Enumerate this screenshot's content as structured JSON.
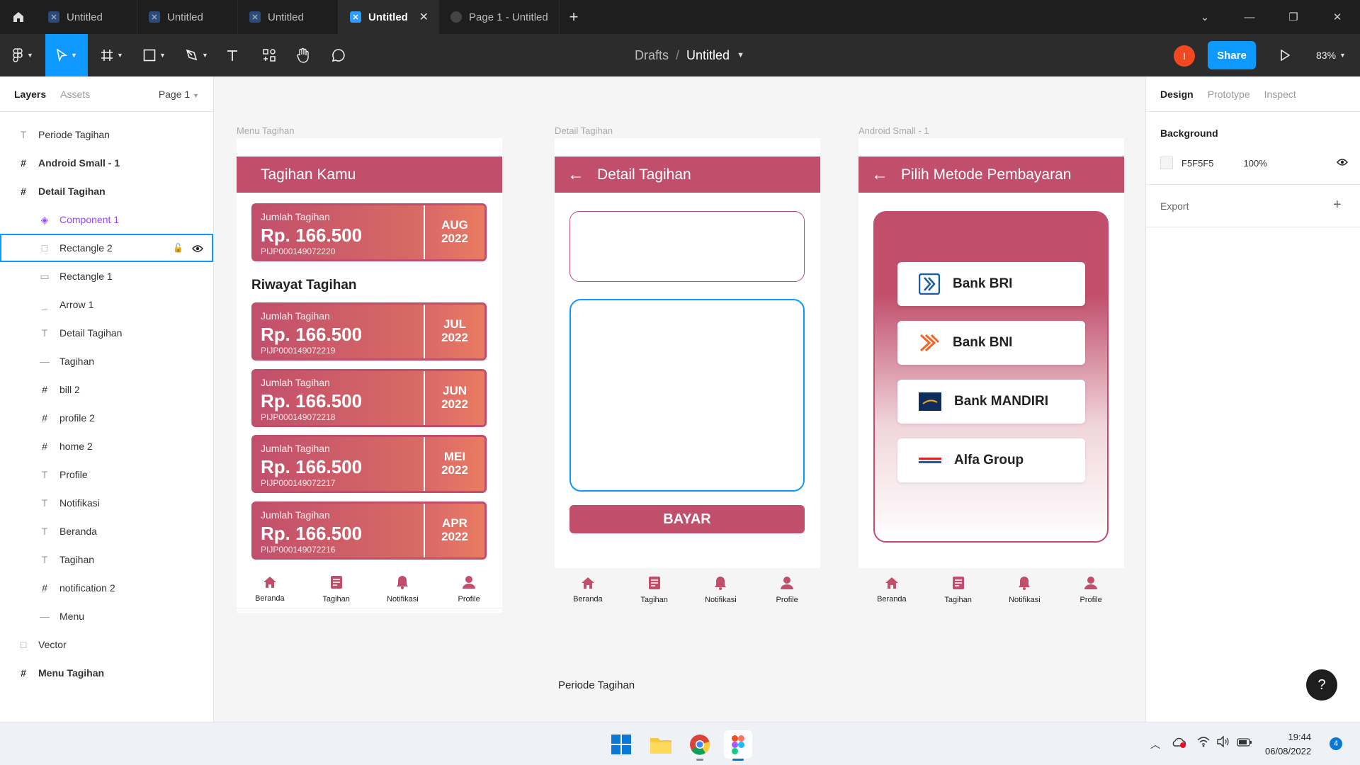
{
  "tabs": [
    {
      "label": "Untitled",
      "active": false
    },
    {
      "label": "Untitled",
      "active": false
    },
    {
      "label": "Untitled",
      "active": false
    },
    {
      "label": "Untitled",
      "active": true
    },
    {
      "label": "Page 1 - Untitled",
      "active": false
    }
  ],
  "toolbar": {
    "breadcrumb_parent": "Drafts",
    "breadcrumb_sep": "/",
    "file_name": "Untitled",
    "avatar_initial": "I",
    "share_label": "Share",
    "zoom": "83%"
  },
  "left_panel": {
    "tab_layers": "Layers",
    "tab_assets": "Assets",
    "page": "Page 1",
    "layers": [
      {
        "label": "Periode Tagihan",
        "icon": "T",
        "indent": 0,
        "bold": false
      },
      {
        "label": "Android Small - 1",
        "icon": "#",
        "indent": 0,
        "bold": true
      },
      {
        "label": "Detail Tagihan",
        "icon": "#",
        "indent": 0,
        "bold": true
      },
      {
        "label": "Component 1",
        "icon": "◈",
        "indent": 1,
        "bold": false,
        "component": true
      },
      {
        "label": "Rectangle 2",
        "icon": "□",
        "indent": 1,
        "bold": false,
        "selected": true
      },
      {
        "label": "Rectangle 1",
        "icon": "▭",
        "indent": 1,
        "bold": false
      },
      {
        "label": "Arrow 1",
        "icon": "_",
        "indent": 1,
        "bold": false
      },
      {
        "label": "Detail Tagihan",
        "icon": "T",
        "indent": 1,
        "bold": false
      },
      {
        "label": "Tagihan",
        "icon": "—",
        "indent": 1,
        "bold": false
      },
      {
        "label": "bill 2",
        "icon": "#",
        "indent": 1,
        "bold": false
      },
      {
        "label": "profile 2",
        "icon": "#",
        "indent": 1,
        "bold": false
      },
      {
        "label": "home 2",
        "icon": "#",
        "indent": 1,
        "bold": false
      },
      {
        "label": "Profile",
        "icon": "T",
        "indent": 1,
        "bold": false
      },
      {
        "label": "Notifikasi",
        "icon": "T",
        "indent": 1,
        "bold": false
      },
      {
        "label": "Beranda",
        "icon": "T",
        "indent": 1,
        "bold": false
      },
      {
        "label": "Tagihan",
        "icon": "T",
        "indent": 1,
        "bold": false
      },
      {
        "label": "notification 2",
        "icon": "#",
        "indent": 1,
        "bold": false
      },
      {
        "label": "Menu",
        "icon": "—",
        "indent": 1,
        "bold": false
      },
      {
        "label": "Vector",
        "icon": "□",
        "indent": 0,
        "bold": false
      },
      {
        "label": "Menu Tagihan",
        "icon": "#",
        "indent": 0,
        "bold": true
      }
    ]
  },
  "canvas": {
    "frame1": {
      "label": "Menu Tagihan",
      "title": "Tagihan Kamu",
      "history_title": "Riwayat Tagihan",
      "current_bill": {
        "label": "Jumlah Tagihan",
        "amount": "Rp. 166.500",
        "code": "PIJP000149072220",
        "month": "AUG",
        "year": "2022"
      },
      "bills": [
        {
          "label": "Jumlah Tagihan",
          "amount": "Rp. 166.500",
          "code": "PIJP000149072219",
          "month": "JUL",
          "year": "2022"
        },
        {
          "label": "Jumlah Tagihan",
          "amount": "Rp. 166.500",
          "code": "PIJP000149072218",
          "month": "JUN",
          "year": "2022"
        },
        {
          "label": "Jumlah Tagihan",
          "amount": "Rp. 166.500",
          "code": "PIJP000149072217",
          "month": "MEI",
          "year": "2022"
        },
        {
          "label": "Jumlah Tagihan",
          "amount": "Rp. 166.500",
          "code": "PIJP000149072216",
          "month": "APR",
          "year": "2022"
        }
      ]
    },
    "frame2": {
      "label": "Detail Tagihan",
      "title": "Detail Tagihan",
      "pay_button": "BAYAR"
    },
    "frame3": {
      "label": "Android Small - 1",
      "title": "Pilih Metode Pembayaran",
      "banks": [
        "Bank BRI",
        "Bank BNI",
        "Bank MANDIRI",
        "Alfa Group"
      ]
    },
    "nav": [
      "Beranda",
      "Tagihan",
      "Notifikasi",
      "Profile"
    ],
    "floating_text": "Periode Tagihan"
  },
  "right_panel": {
    "tabs": [
      "Design",
      "Prototype",
      "Inspect"
    ],
    "background_label": "Background",
    "bg_color": "F5F5F5",
    "bg_opacity": "100%",
    "export_label": "Export"
  },
  "taskbar": {
    "time": "19:44",
    "date": "06/08/2022",
    "notif_count": "4"
  },
  "colors": {
    "accent": "#0d99ff",
    "brand": "#c14f6c",
    "bill_gradient_end": "#e27560"
  }
}
